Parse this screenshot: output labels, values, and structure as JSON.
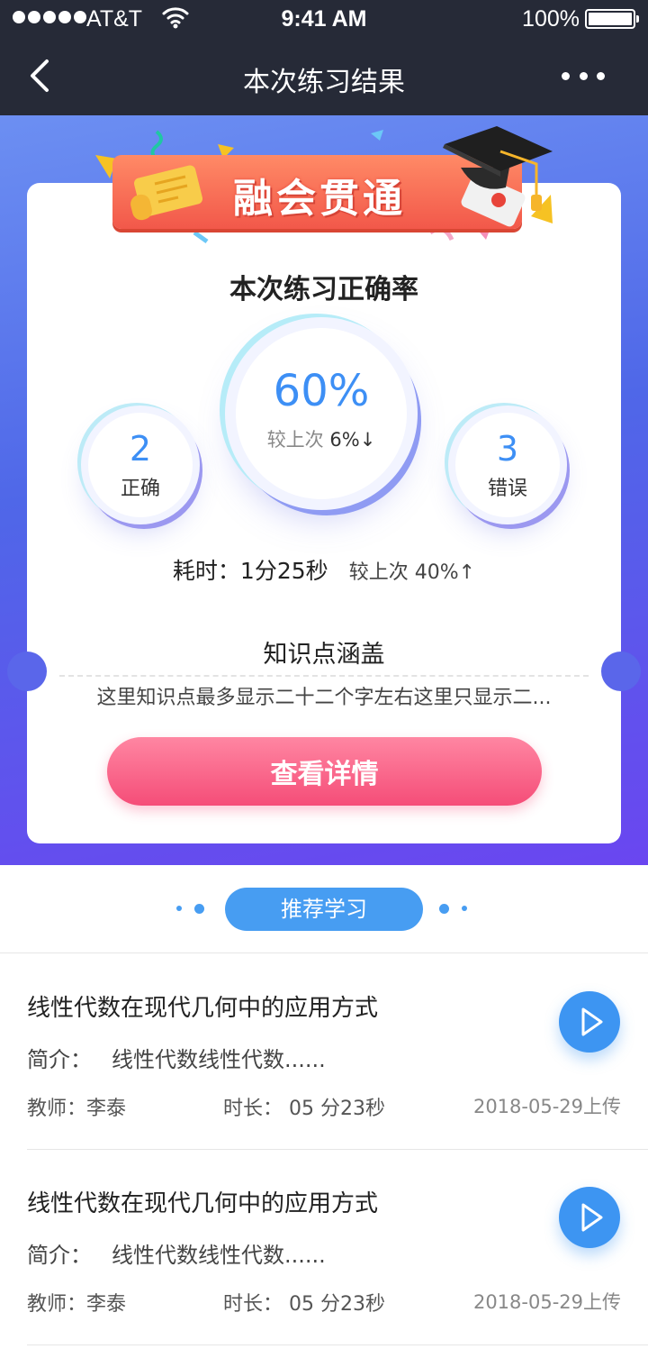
{
  "status_bar": {
    "carrier": "AT&T",
    "time": "9:41 AM",
    "battery": "100%"
  },
  "nav": {
    "title": "本次练习结果"
  },
  "banner": {
    "title": "融会贯通"
  },
  "result": {
    "heading": "本次练习正确率",
    "accuracy": "60%",
    "accuracy_compare_label": "较上次",
    "accuracy_compare_value": "6%↓",
    "correct_count": "2",
    "correct_label": "正确",
    "wrong_count": "3",
    "wrong_label": "错误",
    "time_text": "耗时：1分25秒",
    "time_compare": "较上次 40%↑"
  },
  "knowledge": {
    "title": "知识点涵盖",
    "desc": "这里知识点最多显示二十二个字左右这里只显示二..."
  },
  "detail_button": "查看详情",
  "recommend": {
    "label": "推荐学习",
    "items": [
      {
        "title": "线性代数在现代几何中的应用方式",
        "intro_label": "简介：",
        "intro": "线性代数线性代数......",
        "teacher": "教师：李泰",
        "duration": "时长： 05 分23秒",
        "date": "2018-05-29上传"
      },
      {
        "title": "线性代数在现代几何中的应用方式",
        "intro_label": "简介：",
        "intro": "线性代数线性代数......",
        "teacher": "教师：李泰",
        "duration": "时长： 05 分23秒",
        "date": "2018-05-29上传"
      }
    ]
  },
  "colors": {
    "nav_bg": "#262a37",
    "accent_blue": "#479df2",
    "button_pink": "#f54d78",
    "hero_gradient_start": "#6c8ff2",
    "hero_gradient_end": "#6a46f0"
  },
  "icons": [
    "back-icon",
    "more-icon",
    "wifi-icon",
    "battery-icon",
    "scroll-icon",
    "graduation-cap-icon",
    "play-icon"
  ]
}
